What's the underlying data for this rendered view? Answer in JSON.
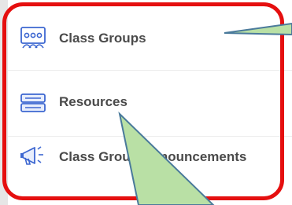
{
  "menu": {
    "items": [
      {
        "label": "Class Groups",
        "icon": "class-groups-icon"
      },
      {
        "label": "Resources",
        "icon": "resources-icon"
      },
      {
        "label": "Class Group Announcements",
        "icon": "megaphone-icon"
      }
    ]
  },
  "colors": {
    "highlight_border": "#e50f0f",
    "callout_fill": "#b9e0a5",
    "callout_stroke": "#4a7a9b",
    "icon_blue": "#3d67d1",
    "label_text": "#4a4a4a"
  }
}
